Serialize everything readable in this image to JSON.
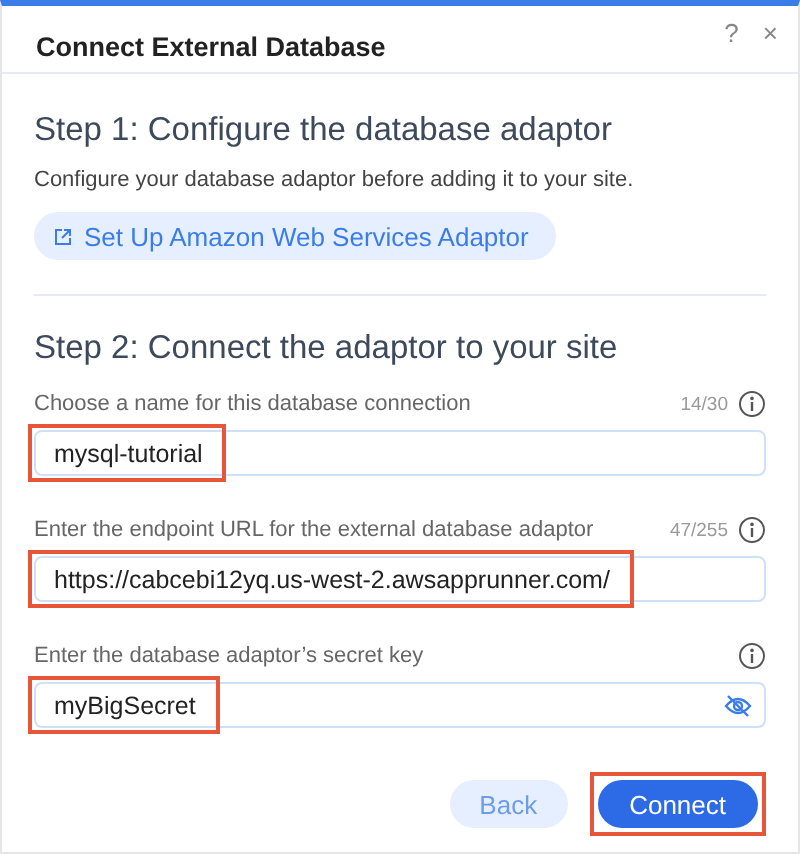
{
  "window": {
    "title": "Connect External Database",
    "help": "?",
    "close": "×"
  },
  "step1": {
    "heading": "Step 1: Configure the database adaptor",
    "description": "Configure your database adaptor before adding it to your site.",
    "link_button": "Set Up Amazon Web Services Adaptor"
  },
  "step2": {
    "heading": "Step 2: Connect the adaptor to your site"
  },
  "fields": [
    {
      "kind": "text",
      "label": "Choose a name for this database connection",
      "counter": "14/30",
      "value": "mysql-tutorial",
      "highlighted": true
    },
    {
      "kind": "text",
      "label": "Enter the endpoint URL for the external database adaptor",
      "counter": "47/255",
      "value": "https://cabcebi12yq.us-west-2.awsapprunner.com/",
      "highlighted": true
    },
    {
      "kind": "secret",
      "label": "Enter the database adaptor’s secret key",
      "value": "myBigSecret",
      "highlighted": true
    }
  ],
  "buttons": [
    {
      "kind": "secondary",
      "label": "Back",
      "highlighted": false
    },
    {
      "kind": "primary",
      "label": "Connect",
      "highlighted": true
    }
  ]
}
